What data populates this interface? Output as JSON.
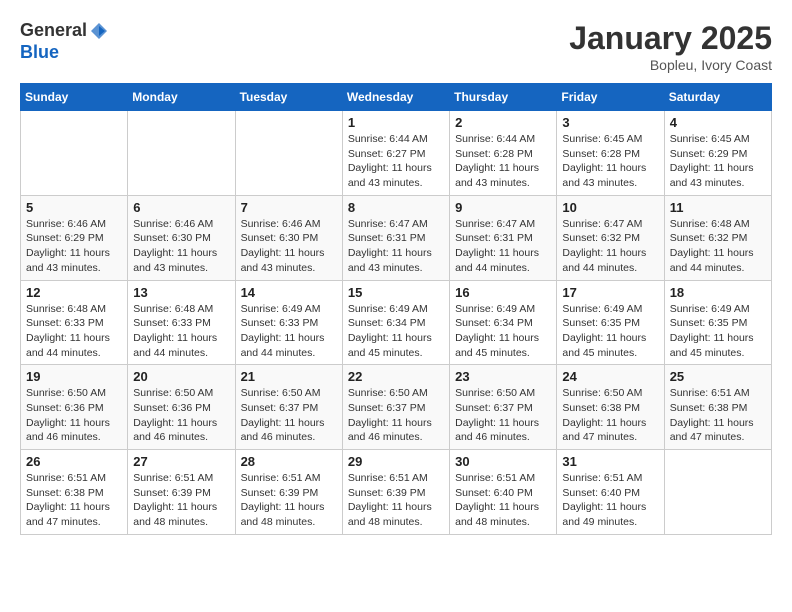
{
  "header": {
    "logo_line1": "General",
    "logo_line2": "Blue",
    "month": "January 2025",
    "location": "Bopleu, Ivory Coast"
  },
  "weekdays": [
    "Sunday",
    "Monday",
    "Tuesday",
    "Wednesday",
    "Thursday",
    "Friday",
    "Saturday"
  ],
  "weeks": [
    [
      {
        "day": "",
        "info": ""
      },
      {
        "day": "",
        "info": ""
      },
      {
        "day": "",
        "info": ""
      },
      {
        "day": "1",
        "info": "Sunrise: 6:44 AM\nSunset: 6:27 PM\nDaylight: 11 hours\nand 43 minutes."
      },
      {
        "day": "2",
        "info": "Sunrise: 6:44 AM\nSunset: 6:28 PM\nDaylight: 11 hours\nand 43 minutes."
      },
      {
        "day": "3",
        "info": "Sunrise: 6:45 AM\nSunset: 6:28 PM\nDaylight: 11 hours\nand 43 minutes."
      },
      {
        "day": "4",
        "info": "Sunrise: 6:45 AM\nSunset: 6:29 PM\nDaylight: 11 hours\nand 43 minutes."
      }
    ],
    [
      {
        "day": "5",
        "info": "Sunrise: 6:46 AM\nSunset: 6:29 PM\nDaylight: 11 hours\nand 43 minutes."
      },
      {
        "day": "6",
        "info": "Sunrise: 6:46 AM\nSunset: 6:30 PM\nDaylight: 11 hours\nand 43 minutes."
      },
      {
        "day": "7",
        "info": "Sunrise: 6:46 AM\nSunset: 6:30 PM\nDaylight: 11 hours\nand 43 minutes."
      },
      {
        "day": "8",
        "info": "Sunrise: 6:47 AM\nSunset: 6:31 PM\nDaylight: 11 hours\nand 43 minutes."
      },
      {
        "day": "9",
        "info": "Sunrise: 6:47 AM\nSunset: 6:31 PM\nDaylight: 11 hours\nand 44 minutes."
      },
      {
        "day": "10",
        "info": "Sunrise: 6:47 AM\nSunset: 6:32 PM\nDaylight: 11 hours\nand 44 minutes."
      },
      {
        "day": "11",
        "info": "Sunrise: 6:48 AM\nSunset: 6:32 PM\nDaylight: 11 hours\nand 44 minutes."
      }
    ],
    [
      {
        "day": "12",
        "info": "Sunrise: 6:48 AM\nSunset: 6:33 PM\nDaylight: 11 hours\nand 44 minutes."
      },
      {
        "day": "13",
        "info": "Sunrise: 6:48 AM\nSunset: 6:33 PM\nDaylight: 11 hours\nand 44 minutes."
      },
      {
        "day": "14",
        "info": "Sunrise: 6:49 AM\nSunset: 6:33 PM\nDaylight: 11 hours\nand 44 minutes."
      },
      {
        "day": "15",
        "info": "Sunrise: 6:49 AM\nSunset: 6:34 PM\nDaylight: 11 hours\nand 45 minutes."
      },
      {
        "day": "16",
        "info": "Sunrise: 6:49 AM\nSunset: 6:34 PM\nDaylight: 11 hours\nand 45 minutes."
      },
      {
        "day": "17",
        "info": "Sunrise: 6:49 AM\nSunset: 6:35 PM\nDaylight: 11 hours\nand 45 minutes."
      },
      {
        "day": "18",
        "info": "Sunrise: 6:49 AM\nSunset: 6:35 PM\nDaylight: 11 hours\nand 45 minutes."
      }
    ],
    [
      {
        "day": "19",
        "info": "Sunrise: 6:50 AM\nSunset: 6:36 PM\nDaylight: 11 hours\nand 46 minutes."
      },
      {
        "day": "20",
        "info": "Sunrise: 6:50 AM\nSunset: 6:36 PM\nDaylight: 11 hours\nand 46 minutes."
      },
      {
        "day": "21",
        "info": "Sunrise: 6:50 AM\nSunset: 6:37 PM\nDaylight: 11 hours\nand 46 minutes."
      },
      {
        "day": "22",
        "info": "Sunrise: 6:50 AM\nSunset: 6:37 PM\nDaylight: 11 hours\nand 46 minutes."
      },
      {
        "day": "23",
        "info": "Sunrise: 6:50 AM\nSunset: 6:37 PM\nDaylight: 11 hours\nand 46 minutes."
      },
      {
        "day": "24",
        "info": "Sunrise: 6:50 AM\nSunset: 6:38 PM\nDaylight: 11 hours\nand 47 minutes."
      },
      {
        "day": "25",
        "info": "Sunrise: 6:51 AM\nSunset: 6:38 PM\nDaylight: 11 hours\nand 47 minutes."
      }
    ],
    [
      {
        "day": "26",
        "info": "Sunrise: 6:51 AM\nSunset: 6:38 PM\nDaylight: 11 hours\nand 47 minutes."
      },
      {
        "day": "27",
        "info": "Sunrise: 6:51 AM\nSunset: 6:39 PM\nDaylight: 11 hours\nand 48 minutes."
      },
      {
        "day": "28",
        "info": "Sunrise: 6:51 AM\nSunset: 6:39 PM\nDaylight: 11 hours\nand 48 minutes."
      },
      {
        "day": "29",
        "info": "Sunrise: 6:51 AM\nSunset: 6:39 PM\nDaylight: 11 hours\nand 48 minutes."
      },
      {
        "day": "30",
        "info": "Sunrise: 6:51 AM\nSunset: 6:40 PM\nDaylight: 11 hours\nand 48 minutes."
      },
      {
        "day": "31",
        "info": "Sunrise: 6:51 AM\nSunset: 6:40 PM\nDaylight: 11 hours\nand 49 minutes."
      },
      {
        "day": "",
        "info": ""
      }
    ]
  ]
}
